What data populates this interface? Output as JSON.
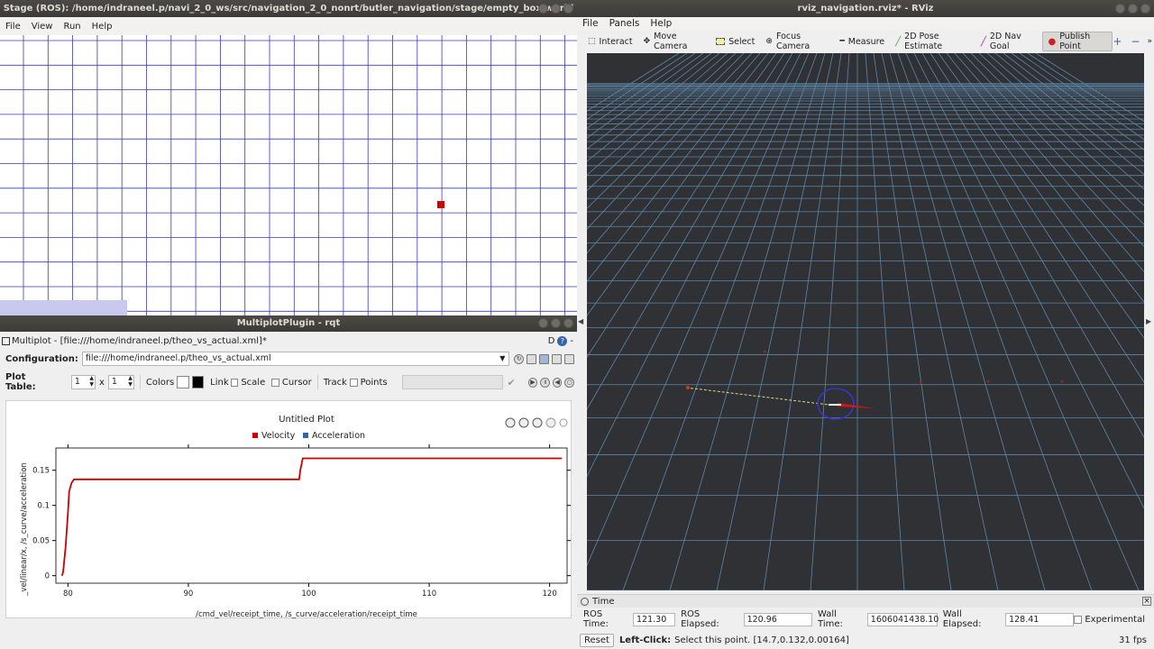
{
  "stage": {
    "title": "Stage (ROS): /home/indraneel.p/navi_2_0_ws/src/navigation_2_0_nonrt/butler_navigation/stage/empty_box.world",
    "menu": [
      "File",
      "View",
      "Run",
      "Help"
    ]
  },
  "rqt": {
    "title": "MultiplotPlugin - rqt",
    "panel_title": "Multiplot - [file:///home/indraneel.p/theo_vs_actual.xml]*",
    "panel_right": "D",
    "config_label": "Configuration:",
    "config_value": "file:///home/indraneel.p/theo_vs_actual.xml",
    "plot_table_label": "Plot Table:",
    "rows": "1",
    "cols": "1",
    "x_sep": "x",
    "colors_label": "Colors",
    "link_label": "Link",
    "scale_label": "Scale",
    "cursor_label": "Cursor",
    "track_label": "Track",
    "points_label": "Points"
  },
  "chart_data": {
    "type": "line",
    "title": "Untitled Plot",
    "xlabel": "/cmd_vel/receipt_time, /s_curve/acceleration/receipt_time",
    "ylabel": "_vel/linear/x, /s_curve/acceleration",
    "xlim": [
      79,
      121
    ],
    "ylim": [
      -0.003,
      0.174
    ],
    "x_ticks": [
      80,
      90,
      100,
      110,
      120
    ],
    "y_ticks": [
      0,
      0.05,
      0.1,
      0.15
    ],
    "x_tick_labels": [
      "80",
      "90",
      "100",
      "110",
      "120"
    ],
    "y_tick_labels": [
      "0",
      "0.05",
      "0.1",
      "0.15"
    ],
    "legend_position": "top-center",
    "series": [
      {
        "name": "Velocity",
        "color": "#cc0000",
        "x": [
          79.5,
          79.6,
          79.8,
          80.0,
          80.1,
          80.3,
          80.5,
          99.2,
          99.3,
          99.5,
          121.0
        ],
        "y": [
          0.0,
          0.005,
          0.04,
          0.09,
          0.12,
          0.132,
          0.137,
          0.137,
          0.15,
          0.167,
          0.167
        ]
      },
      {
        "name": "Acceleration",
        "color": "#3465a4",
        "x": [],
        "y": []
      }
    ]
  },
  "rviz": {
    "title": "rviz_navigation.rviz* - RViz",
    "menu": [
      "File",
      "Panels",
      "Help"
    ],
    "tools": [
      {
        "label": "Interact",
        "icon": "interact-icon"
      },
      {
        "label": "Move Camera",
        "icon": "move-camera-icon"
      },
      {
        "label": "Select",
        "icon": "select-icon"
      },
      {
        "label": "Focus Camera",
        "icon": "focus-camera-icon"
      },
      {
        "label": "Measure",
        "icon": "measure-icon"
      },
      {
        "label": "2D Pose Estimate",
        "icon": "pose-estimate-icon"
      },
      {
        "label": "2D Nav Goal",
        "icon": "nav-goal-icon"
      },
      {
        "label": "Publish Point",
        "icon": "publish-point-icon"
      }
    ],
    "time_panel": {
      "title": "Time",
      "ros_time_label": "ROS Time:",
      "ros_time": "121.30",
      "ros_elapsed_label": "ROS Elapsed:",
      "ros_elapsed": "120.96",
      "wall_time_label": "Wall Time:",
      "wall_time": "1606041438.10",
      "wall_elapsed_label": "Wall Elapsed:",
      "wall_elapsed": "128.41",
      "experimental_label": "Experimental"
    },
    "status": {
      "reset_label": "Reset",
      "hint_bold": "Left-Click:",
      "hint_text": "Select this point. [14.7,0.132,0.00164]",
      "fps": "31 fps"
    }
  }
}
